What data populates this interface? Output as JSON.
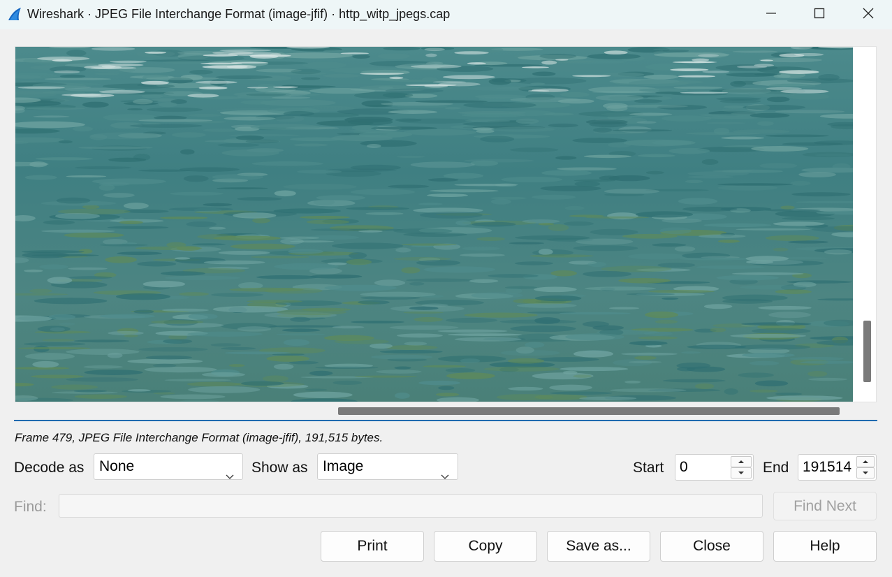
{
  "window": {
    "title": "Wireshark · JPEG File Interchange Format (image-jfif) · http_witp_jpegs.cap",
    "app_icon": "wireshark-fin-icon",
    "controls": {
      "minimize": "minimize-icon",
      "maximize": "maximize-icon",
      "close": "close-icon"
    }
  },
  "viewer": {
    "content": "decoded-jpeg-image",
    "image_colors": {
      "water_dark": "#2f6f72",
      "water_mid": "#4f8c8c",
      "water_light": "#6fa3a0",
      "water_green": "#5e8a5a"
    }
  },
  "info": {
    "text": "Frame 479, JPEG File Interchange Format (image-jfif), 191,515 bytes."
  },
  "controls": {
    "decode_as_label": "Decode as",
    "decode_as_value": "None",
    "show_as_label": "Show as",
    "show_as_value": "Image",
    "start_label": "Start",
    "start_value": "0",
    "end_label": "End",
    "end_value": "191514"
  },
  "find": {
    "label": "Find:",
    "value": "",
    "find_next_label": "Find Next"
  },
  "buttons": {
    "print": "Print",
    "copy": "Copy",
    "save_as": "Save as...",
    "close": "Close",
    "help": "Help"
  },
  "colors": {
    "accent": "#1f6bb0",
    "titlebar": "#eef6f7",
    "background": "#f0f0f0"
  }
}
